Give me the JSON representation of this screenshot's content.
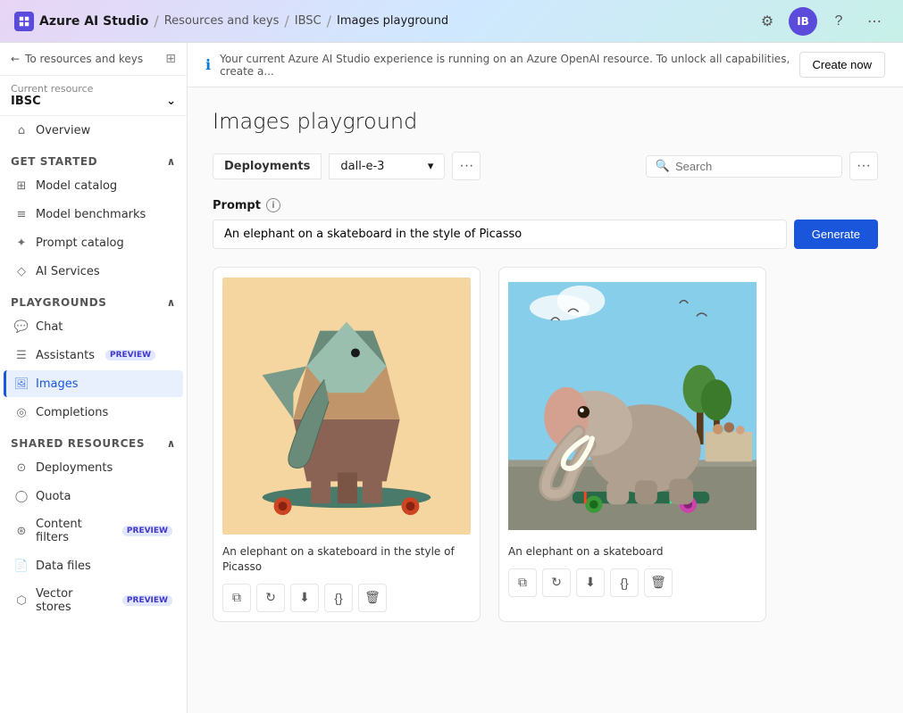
{
  "topnav": {
    "brand": "Azure AI Studio",
    "breadcrumbs": [
      "Resources and keys",
      "IBSC",
      "Images playground"
    ],
    "avatar_initials": "IB"
  },
  "sidebar": {
    "back_label": "To resources and keys",
    "resource_label": "Current resource",
    "resource_name": "IBSC",
    "overview_label": "Overview",
    "get_started": {
      "section_label": "Get started",
      "items": [
        {
          "label": "Model catalog",
          "icon": "model-catalog"
        },
        {
          "label": "Model benchmarks",
          "icon": "model-benchmarks"
        },
        {
          "label": "Prompt catalog",
          "icon": "prompt-catalog"
        },
        {
          "label": "AI Services",
          "icon": "ai-services"
        }
      ]
    },
    "playgrounds": {
      "section_label": "Playgrounds",
      "items": [
        {
          "label": "Chat",
          "icon": "chat",
          "active": false
        },
        {
          "label": "Assistants",
          "icon": "assistants",
          "active": false,
          "badge": "PREVIEW"
        },
        {
          "label": "Images",
          "icon": "images",
          "active": true
        },
        {
          "label": "Completions",
          "icon": "completions",
          "active": false
        }
      ]
    },
    "shared_resources": {
      "section_label": "Shared resources",
      "items": [
        {
          "label": "Deployments",
          "icon": "deployments"
        },
        {
          "label": "Quota",
          "icon": "quota"
        },
        {
          "label": "Content filters",
          "icon": "content-filters",
          "badge": "PREVIEW"
        },
        {
          "label": "Data files",
          "icon": "data-files"
        },
        {
          "label": "Vector stores",
          "icon": "vector-stores",
          "badge": "PREVIEW"
        }
      ]
    }
  },
  "notification": {
    "text": "Your current Azure AI Studio experience is running on an Azure OpenAI resource. To unlock all capabilities, create a...",
    "button_label": "Create now"
  },
  "page": {
    "title": "Images playground",
    "toolbar": {
      "deployments_label": "Deployments",
      "deployment_value": "dall-e-3",
      "search_placeholder": "Search"
    },
    "prompt": {
      "label": "Prompt",
      "value": "An elephant on a skateboard in the style of Picasso",
      "generate_label": "Generate"
    },
    "images": [
      {
        "caption": "An elephant on a skateboard in the style of Picasso",
        "style": "picasso"
      },
      {
        "caption": "An elephant on a skateboard",
        "style": "realistic"
      }
    ],
    "image_actions": [
      "copy",
      "refresh",
      "download",
      "json",
      "delete"
    ]
  }
}
